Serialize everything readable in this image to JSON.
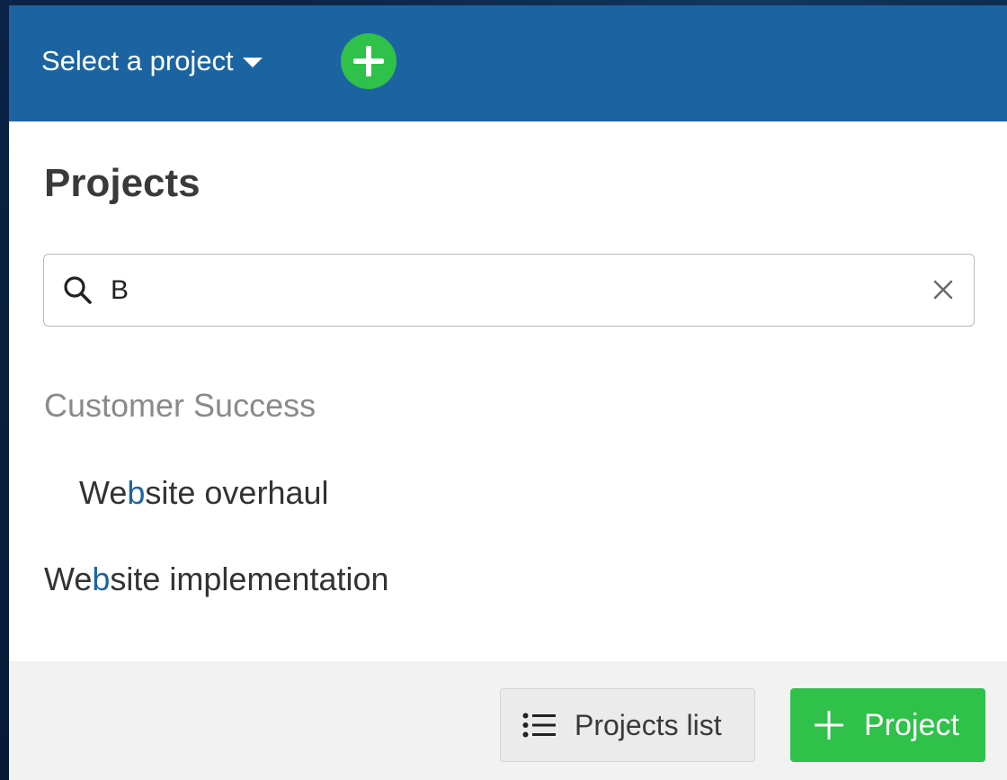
{
  "header": {
    "project_select_label": "Select a project",
    "add_button_icon": "plus-icon"
  },
  "main": {
    "title": "Projects",
    "search": {
      "value": "B",
      "icons": [
        "search-icon",
        "close-icon"
      ]
    },
    "results": {
      "group_label": "Customer Success",
      "items": [
        {
          "prefix": "We",
          "highlight": "b",
          "suffix": "site overhaul"
        },
        {
          "prefix": "We",
          "highlight": "b",
          "suffix": "site implementation"
        }
      ]
    }
  },
  "footer": {
    "projects_list_label": "Projects list",
    "new_project_label": "Project"
  },
  "colors": {
    "header_blue": "#1c64a1",
    "accent_green": "#2fc14a",
    "highlight_blue": "#1c64a1"
  }
}
